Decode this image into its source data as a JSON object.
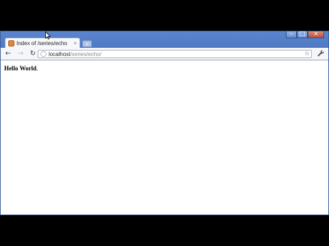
{
  "browser": {
    "tab": {
      "title": "Index of /series/echo",
      "close_glyph": "×",
      "favicon": "page-icon"
    },
    "new_tab_glyph": "+",
    "window_controls": {
      "minimize": "–",
      "maximize": "□",
      "close": "×"
    },
    "toolbar": {
      "back": "←",
      "forward": "→",
      "reload": "↻",
      "address": {
        "host": "localhost",
        "path": "/series/echo/"
      },
      "bookmark_glyph": "☆",
      "wrench_glyph": "🔧"
    }
  },
  "page": {
    "text_bold": "Hello World",
    "text_suffix": "."
  },
  "colors": {
    "titlebar": "#5b86cf",
    "favicon": "#e2843a"
  }
}
